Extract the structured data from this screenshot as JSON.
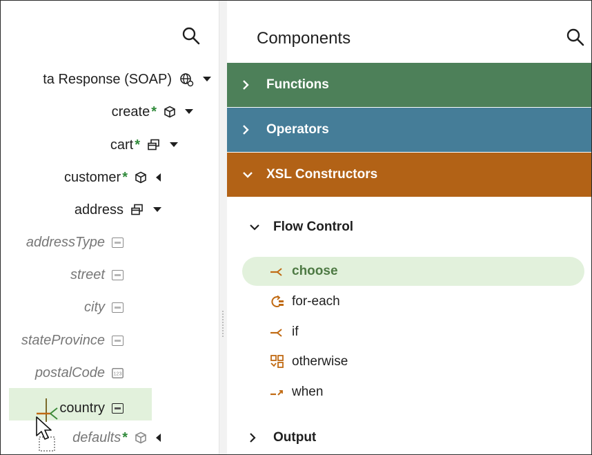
{
  "tree": {
    "rows": [
      {
        "label": "ta Response (SOAP)",
        "required": false,
        "type_icon": "globe-icon",
        "caret": "caret-down-icon"
      },
      {
        "label": "create",
        "required": true,
        "type_icon": "cube-icon",
        "caret": "caret-down-icon"
      },
      {
        "label": "cart",
        "required": true,
        "type_icon": "windows-icon",
        "caret": "caret-down-icon"
      },
      {
        "label": "customer",
        "required": true,
        "type_icon": "cube-icon",
        "caret": "caret-left-icon"
      },
      {
        "label": "address",
        "required": false,
        "type_icon": "windows-icon",
        "caret": "caret-down-icon"
      },
      {
        "label": "addressType",
        "required": false,
        "type_icon": "abc-icon"
      },
      {
        "label": "street",
        "required": false,
        "type_icon": "abc-icon"
      },
      {
        "label": "city",
        "required": false,
        "type_icon": "abc-icon"
      },
      {
        "label": "stateProvince",
        "required": false,
        "type_icon": "abc-icon"
      },
      {
        "label": "postalCode",
        "required": false,
        "type_icon": "number-icon"
      },
      {
        "label": "country",
        "required": false,
        "type_icon": "abc-icon",
        "selected": true
      },
      {
        "label": "defaults",
        "required": true,
        "type_icon": "cube-icon",
        "caret": "caret-left-icon"
      }
    ],
    "required_marker": "*"
  },
  "components": {
    "title": "Components",
    "bands": {
      "functions": "Functions",
      "operators": "Operators",
      "xsl": "XSL Constructors"
    },
    "flow_control": "Flow Control",
    "items": [
      {
        "label": "choose",
        "icon": "choose-icon",
        "selected": true
      },
      {
        "label": "for-each",
        "icon": "for-each-icon"
      },
      {
        "label": "if",
        "icon": "if-icon"
      },
      {
        "label": "otherwise",
        "icon": "otherwise-icon"
      },
      {
        "label": "when",
        "icon": "when-icon"
      }
    ],
    "output": "Output"
  },
  "colors": {
    "functions_band": "#4d8059",
    "operators_band": "#457d98",
    "xsl_band": "#b26216",
    "selection": "#e2f1dc",
    "required_star": "#2f8a3a",
    "item_icon_orange": "#c06a12"
  }
}
